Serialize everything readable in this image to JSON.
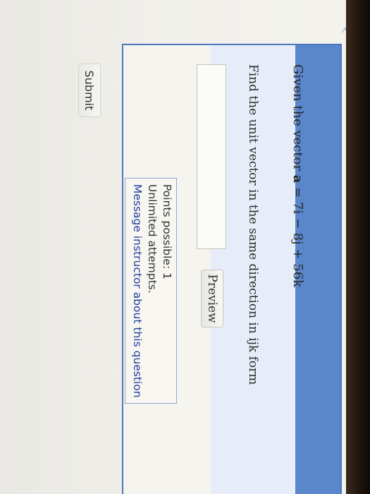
{
  "question": {
    "stem_prefix": "Given the vector ",
    "vector_symbol": "a",
    "vector_expression": " = 7i − 8j + 56k",
    "task": "Find the unit vector in the same direction in ijk form",
    "answer_value": "",
    "preview_label": "Preview"
  },
  "info": {
    "points": "Points possible: 1",
    "attempts": "Unlimited attempts.",
    "message_link": "Message instructor about this question"
  },
  "actions": {
    "submit_label": "Submit"
  },
  "colors": {
    "panel_border": "#4d78c0",
    "header_fill": "#5a86cc",
    "link": "#1f3f9f"
  }
}
